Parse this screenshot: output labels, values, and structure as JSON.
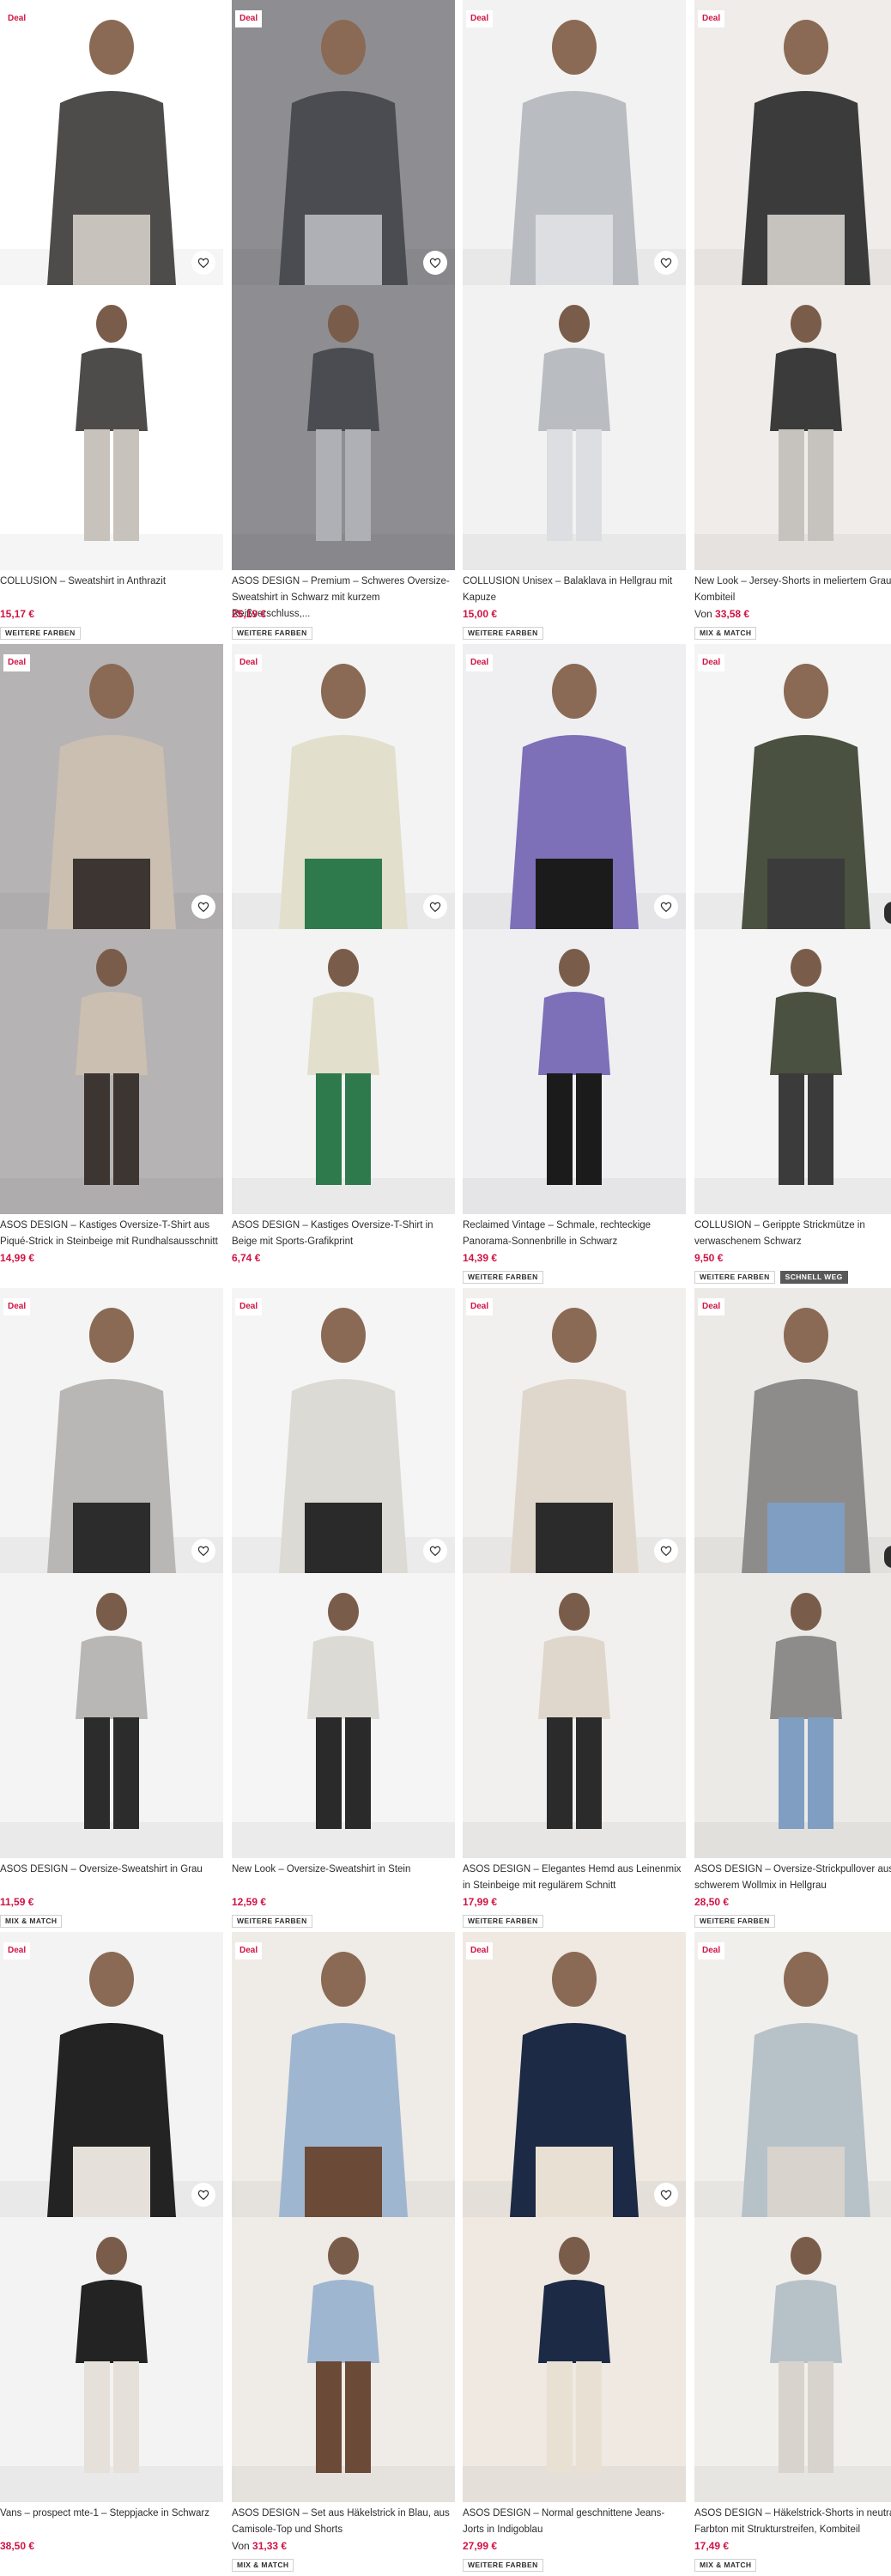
{
  "labels": {
    "deal": "Deal"
  },
  "products": [
    {
      "title": "COLLUSION – Sweatshirt in Anthrazit",
      "price": "15,17 €",
      "price_prefix": "",
      "badges": [
        "WEITERE FARBEN"
      ],
      "deal": true,
      "heart": true,
      "bg": "#ffffff",
      "accent": "#4e4c4b",
      "accent2": "#c8c2bc"
    },
    {
      "title": "ASOS DESIGN – Premium – Schweres Oversize-Sweatshirt in Schwarz mit kurzem Reißverschluss,...",
      "price": "25,19 €",
      "price_prefix": "",
      "badges": [
        "WEITERE FARBEN"
      ],
      "deal": true,
      "heart": true,
      "bg": "#8e8e92",
      "accent": "#4a4c52",
      "accent2": "#aeb0b5"
    },
    {
      "title": "COLLUSION Unisex – Balaklava in Hellgrau mit Kapuze",
      "price": "15,00 €",
      "price_prefix": "",
      "badges": [
        "WEITERE FARBEN"
      ],
      "deal": true,
      "heart": true,
      "bg": "#f2f2f2",
      "accent": "#b9bcc1",
      "accent2": "#dcdee1"
    },
    {
      "title": "New Look – Jersey-Shorts in meliertem Grau, Kombiteil",
      "price": "33,58 €",
      "price_prefix": "Von",
      "badges": [
        "MIX & MATCH"
      ],
      "deal": true,
      "heart": false,
      "bg": "#efece9",
      "accent": "#3b3b3b",
      "accent2": "#c6c3bf"
    },
    {
      "title": "ASOS DESIGN – Kastiges Oversize-T-Shirt aus Piqué-Strick in Steinbeige mit Rundhalsausschnitt",
      "price": "14,99 €",
      "price_prefix": "",
      "badges": [],
      "deal": true,
      "heart": true,
      "bg": "#b6b3b4",
      "accent": "#cbbfb2",
      "accent2": "#3d3531"
    },
    {
      "title": "ASOS DESIGN – Kastiges Oversize-T-Shirt in Beige mit Sports-Grafikprint",
      "price": "6,74 €",
      "price_prefix": "",
      "badges": [],
      "deal": true,
      "heart": true,
      "bg": "#f3f3f3",
      "accent": "#e2dfcc",
      "accent2": "#2f7a4c"
    },
    {
      "title": "Reclaimed Vintage – Schmale, rechteckige Panorama-Sonnenbrille in Schwarz",
      "price": "14,39 €",
      "price_prefix": "",
      "badges": [
        "WEITERE FARBEN"
      ],
      "deal": true,
      "heart": true,
      "bg": "#efeff1",
      "accent": "#7d6fb8",
      "accent2": "#1b1b1b"
    },
    {
      "title": "COLLUSION – Gerippte Strickmütze in verwaschenem Schwarz",
      "price": "9,50 €",
      "price_prefix": "",
      "badges": [
        "WEITERE FARBEN",
        "SCHNELL WEG"
      ],
      "deal": true,
      "heart": false,
      "bg": "#f4f4f4",
      "accent": "#4b5140",
      "accent2": "#3b3b3b"
    },
    {
      "title": "ASOS DESIGN – Oversize-Sweatshirt in Grau",
      "price": "11,59 €",
      "price_prefix": "",
      "badges": [
        "MIX & MATCH"
      ],
      "deal": true,
      "heart": true,
      "bg": "#f4f4f4",
      "accent": "#b9b7b5",
      "accent2": "#2c2c2c"
    },
    {
      "title": "New Look – Oversize-Sweatshirt in Stein",
      "price": "12,59 €",
      "price_prefix": "",
      "badges": [
        "WEITERE FARBEN"
      ],
      "deal": true,
      "heart": true,
      "bg": "#f5f5f5",
      "accent": "#dcdad4",
      "accent2": "#2a2a2a"
    },
    {
      "title": "ASOS DESIGN – Elegantes Hemd aus Leinenmix in Steinbeige mit regulärem Schnitt",
      "price": "17,99 €",
      "price_prefix": "",
      "badges": [
        "WEITERE FARBEN"
      ],
      "deal": true,
      "heart": true,
      "bg": "#f1f0ee",
      "accent": "#e0d7cc",
      "accent2": "#2b2b2b"
    },
    {
      "title": "ASOS DESIGN – Oversize-Strickpullover aus schwerem Wollmix in Hellgrau",
      "price": "28,50 €",
      "price_prefix": "",
      "badges": [
        "WEITERE FARBEN"
      ],
      "deal": true,
      "heart": false,
      "bg": "#eceae7",
      "accent": "#8e8c8a",
      "accent2": "#7f9ec2"
    },
    {
      "title": "Vans – prospect mte-1 – Steppjacke in Schwarz",
      "price": "38,50 €",
      "price_prefix": "",
      "badges": [],
      "deal": true,
      "heart": true,
      "bg": "#f3f3f3",
      "accent": "#232323",
      "accent2": "#e5e1da"
    },
    {
      "title": "ASOS DESIGN – Set aus Häkelstrick in Blau, aus Camisole-Top und Shorts",
      "price": "31,33 €",
      "price_prefix": "Von",
      "badges": [
        "MIX & MATCH"
      ],
      "deal": true,
      "heart": false,
      "bg": "#efebe6",
      "accent": "#9fb6d1",
      "accent2": "#6b4a37"
    },
    {
      "title": "ASOS DESIGN – Normal geschnittene Jeans-Jorts in Indigoblau",
      "price": "27,99 €",
      "price_prefix": "",
      "badges": [
        "WEITERE FARBEN"
      ],
      "deal": true,
      "heart": true,
      "bg": "#efe9e2",
      "accent": "#1d2a45",
      "accent2": "#e8e1d3"
    },
    {
      "title": "ASOS DESIGN – Häkelstrick-Shorts in neutralen Farbton mit Strukturstreifen, Kombiteil",
      "price": "17,49 €",
      "price_prefix": "",
      "badges": [
        "MIX & MATCH"
      ],
      "deal": true,
      "heart": false,
      "bg": "#f0efec",
      "accent": "#b7c2c8",
      "accent2": "#d8d3cc"
    }
  ]
}
